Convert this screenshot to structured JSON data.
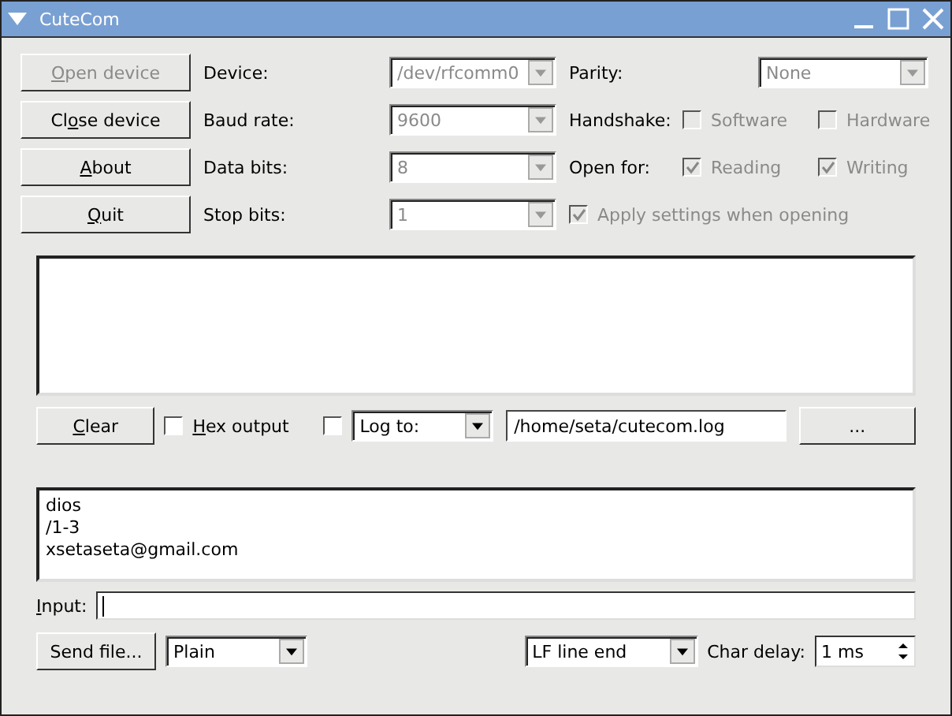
{
  "window": {
    "title": "CuteCom"
  },
  "buttons": [
    {
      "label_parts": [
        {
          "text": "O",
          "underline": true
        },
        {
          "text": "pen device",
          "underline": false
        }
      ],
      "disabled": true
    },
    {
      "label_parts": [
        {
          "text": "Cl",
          "underline": false
        },
        {
          "text": "o",
          "underline": true
        },
        {
          "text": "se device",
          "underline": false
        }
      ],
      "disabled": false
    },
    {
      "label_parts": [
        {
          "text": "A",
          "underline": true
        },
        {
          "text": "bout",
          "underline": false
        }
      ],
      "disabled": false
    },
    {
      "label_parts": [
        {
          "text": "Q",
          "underline": true
        },
        {
          "text": "uit",
          "underline": false
        }
      ],
      "disabled": false
    }
  ],
  "settings": [
    {
      "label": "Device:",
      "value": "/dev/rfcomm0",
      "disabled": true
    },
    {
      "label": "Baud rate:",
      "value": "9600",
      "disabled": true
    },
    {
      "label": "Data bits:",
      "value": "8",
      "disabled": true
    },
    {
      "label": "Stop bits:",
      "value": "1",
      "disabled": true
    }
  ],
  "parity": {
    "label": "Parity:",
    "value": "None",
    "disabled": true
  },
  "handshake": {
    "label": "Handshake:",
    "options": [
      {
        "label": "Software",
        "checked": false,
        "disabled": true
      },
      {
        "label": "Hardware",
        "checked": false,
        "disabled": true
      }
    ]
  },
  "open_for": {
    "label": "Open for:",
    "options": [
      {
        "label": "Reading",
        "checked": true,
        "disabled": true
      },
      {
        "label": "Writing",
        "checked": true,
        "disabled": true
      }
    ]
  },
  "apply_settings": {
    "label": "Apply settings when opening",
    "checked": true,
    "disabled": true
  },
  "output_controls": {
    "clear": {
      "label_parts": [
        {
          "text": "C",
          "underline": true
        },
        {
          "text": "lear",
          "underline": false
        }
      ]
    },
    "hex_output": {
      "label_parts": [
        {
          "text": "H",
          "underline": true
        },
        {
          "text": "ex output",
          "underline": false
        }
      ],
      "checked": false
    },
    "log_enabled": {
      "checked": false
    },
    "log_mode": "Log to:",
    "log_path": "/home/seta/cutecom.log",
    "browse": "..."
  },
  "history": [
    "dios",
    "/1-3",
    "xsetaseta@gmail.com"
  ],
  "input": {
    "label_parts": [
      {
        "text": "I",
        "underline": true
      },
      {
        "text": "nput:",
        "underline": false
      }
    ]
  },
  "bottom": {
    "send_file": "Send file...",
    "protocol": "Plain",
    "line_end": "LF line end",
    "char_delay_label": "Char delay:",
    "char_delay": "1 ms"
  }
}
